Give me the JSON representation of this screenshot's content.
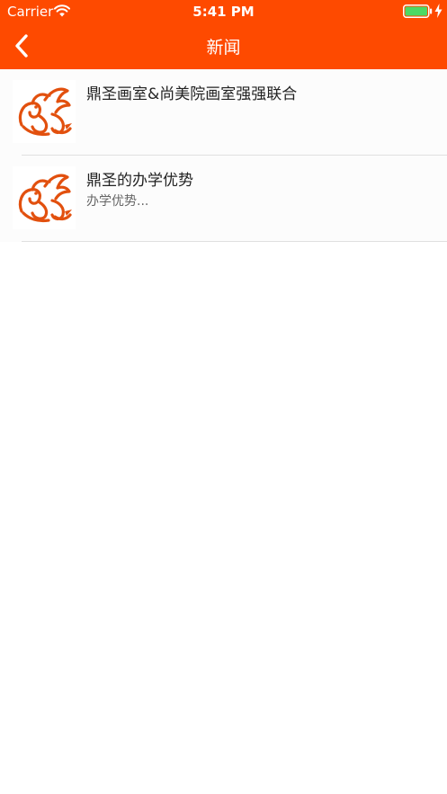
{
  "status_bar": {
    "carrier": "Carrier",
    "time": "5:41 PM"
  },
  "nav": {
    "title": "新闻"
  },
  "news": [
    {
      "title": "鼎圣画室&尚美院画室强强联合",
      "summary": ""
    },
    {
      "title": "鼎圣的办学优势",
      "summary": "办学优势..."
    }
  ],
  "colors": {
    "header": "#fe4a00",
    "logo": "#e2500e",
    "battery": "#4cd964"
  },
  "icons": {
    "back": "chevron-left-icon",
    "wifi": "wifi-icon",
    "battery": "battery-icon",
    "charging": "charging-bolt-icon",
    "thumb": "dragon-logo-icon"
  }
}
